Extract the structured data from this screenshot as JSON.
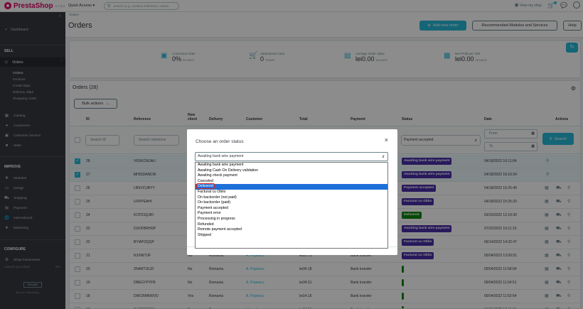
{
  "topbar": {
    "logo": "PrestaShop",
    "version": "1.7.8.2",
    "quick_access": "Quick Access ▾",
    "search_placeholder": "Search (e.g.: product reference, custon",
    "view_shop": "View my shop",
    "notif_count": "1"
  },
  "sidebar": {
    "dashboard": "Dashboard",
    "sell": "SELL",
    "orders": "Orders",
    "sub": [
      "Orders",
      "Invoices",
      "Credit Slips",
      "Delivery Slips",
      "Shopping Carts"
    ],
    "items": [
      "Catalog",
      "Customers",
      "Customer Service",
      "Stats"
    ],
    "improve": "IMPROVE",
    "improve_items": [
      "Modules",
      "Design",
      "Shipping",
      "Payment",
      "International",
      "Marketing"
    ],
    "configure": "CONFIGURE",
    "configure_items": [
      "Shop Parameters"
    ],
    "launch": "Launch your shop!",
    "launch_pct": "0%",
    "resume": "RESUME",
    "stop": "Stop the OnBoarding"
  },
  "header": {
    "breadcrumb": "Orders",
    "title": "Orders",
    "add_order": "Add new order",
    "recommended": "Recommended Modules and Services",
    "help": "Help"
  },
  "kpis": [
    {
      "label": "Conversion Rate",
      "value": "0%",
      "period": "30 DAYS",
      "icon": "conversion-icon"
    },
    {
      "label": "Abandoned Carts",
      "value": "0",
      "period": "TODAY",
      "icon": "cart-icon"
    },
    {
      "label": "Average Order Value",
      "value": "lei0.00",
      "period": "30 DAYS",
      "icon": "order-value-icon"
    },
    {
      "label": "Net Profit per Visit",
      "value": "lei0.00",
      "period": "30 DAYS",
      "icon": "profit-icon"
    }
  ],
  "orders": {
    "title": "Orders (28)",
    "bulk": "Bulk actions",
    "columns": [
      "ID",
      "Reference",
      "New client",
      "Delivery",
      "Customer",
      "Total",
      "Payment",
      "Status",
      "Date",
      "Actions"
    ],
    "filters": {
      "id": "Search ID",
      "reference": "Search reference",
      "status": "Payment accepted",
      "from": "From",
      "to": "To",
      "search": "Search"
    },
    "rows": [
      {
        "id": "28",
        "ref": "VRSKCMJAU",
        "new": "",
        "delivery": "",
        "customer": "",
        "total": "",
        "payment": "",
        "status": "Awaiting bank wire payment",
        "status_color": "#4a2fa8",
        "date": "04/18/2022 16:11:04",
        "checked": true
      },
      {
        "id": "27",
        "ref": "MHISDANCW",
        "new": "",
        "delivery": "",
        "customer": "",
        "total": "",
        "payment": "",
        "status": "Awaiting bank wire payment",
        "status_color": "#4a2fa8",
        "date": "04/18/2022 16:10:24",
        "checked": true
      },
      {
        "id": "26",
        "ref": "LBSVCUBYY",
        "new": "",
        "delivery": "",
        "customer": "",
        "total": "",
        "payment": "",
        "status": "Payment accepted",
        "status_color": "#4a2fa8",
        "date": "04/18/2022 15:25:49",
        "checked": false
      },
      {
        "id": "25",
        "ref": "UXPPEAHI",
        "new": "",
        "delivery": "",
        "customer": "",
        "total": "",
        "payment": "",
        "status": "Facturat cu Oblio",
        "status_color": "#4a2fa8",
        "date": "04/18/2022 15:25:20",
        "checked": false
      },
      {
        "id": "24",
        "ref": "KCPZSQJRI",
        "new": "Yes",
        "delivery": "",
        "customer": "",
        "total": "",
        "payment": "",
        "status": "Delivered",
        "status_color": "#108510",
        "date": "03/15/2022 12:19:30",
        "checked": false
      },
      {
        "id": "23",
        "ref": "DSOFBRHDP",
        "new": "Yes",
        "delivery": "",
        "customer": "",
        "total": "",
        "payment": "",
        "status": "Awaiting bank wire payment",
        "status_color": "#4a2fa8",
        "date": "07/22/2022 10:11:15",
        "checked": false
      },
      {
        "id": "22",
        "ref": "BYIAPZQQP",
        "new": "Yes",
        "delivery": "",
        "customer": "",
        "total": "",
        "payment": "",
        "status": "Facturat cu Oblio",
        "status_color": "#4a2fa8",
        "date": "06/14/2022 14:32:47",
        "checked": false
      },
      {
        "id": "21",
        "ref": "NJXNITUF",
        "new": "No",
        "delivery": "Romania",
        "customer": "A. Popescu",
        "total": "lei22.75",
        "payment": "Bank transfer",
        "status": "Facturat cu Oblio",
        "status_color": "#4a2fa8",
        "date": "05/04/2022 12:00:51",
        "checked": false
      },
      {
        "id": "20",
        "ref": "ZNARTUUZI",
        "new": "No",
        "delivery": "Romania",
        "customer": "A. Popescu",
        "total": "lei34.18",
        "payment": "Bank transfer",
        "status": "",
        "status_color": "#108510",
        "date": "05/04/2022 11:58:04",
        "checked": false
      },
      {
        "id": "19",
        "ref": "DBEGYPYFB",
        "new": "No",
        "delivery": "Romania",
        "customer": "A. Popescu",
        "total": "lei34.51",
        "payment": "Bank transfer",
        "status": "",
        "status_color": "#108510",
        "date": "05/04/2022 11:54:51",
        "checked": false
      },
      {
        "id": "18",
        "ref": "DWCRMKWVD",
        "new": "Yes",
        "delivery": "Romania",
        "customer": "A. Popescu",
        "total": "lei14.16",
        "payment": "Bank transfer",
        "status": "",
        "status_color": "#108510",
        "date": "05/04/2022 11:53:54",
        "checked": false
      },
      {
        "id": "17",
        "ref": "BLSFCQDPY",
        "new": "No",
        "delivery": "Romania",
        "customer": "I. Ionel",
        "total": "lei34.51",
        "payment": "Bank transfer",
        "status": "",
        "status_color": "#108510",
        "date": "04/21/2022 12:11:31",
        "checked": false
      }
    ]
  },
  "modal": {
    "title": "Choose an order status",
    "selected": "Awaiting bank wire payment",
    "options": [
      "Awaiting bank wire payment",
      "Awaiting Cash On Delivery validation",
      "Awaiting check payment",
      "Canceled",
      "Delivered",
      "Facturat cu Oblio",
      "On backorder (not paid)",
      "On backorder (paid)",
      "Payment accepted",
      "Payment error",
      "Processing in progress",
      "Refunded",
      "Remote payment accepted",
      "Shipped"
    ],
    "highlighted": "Delivered"
  }
}
